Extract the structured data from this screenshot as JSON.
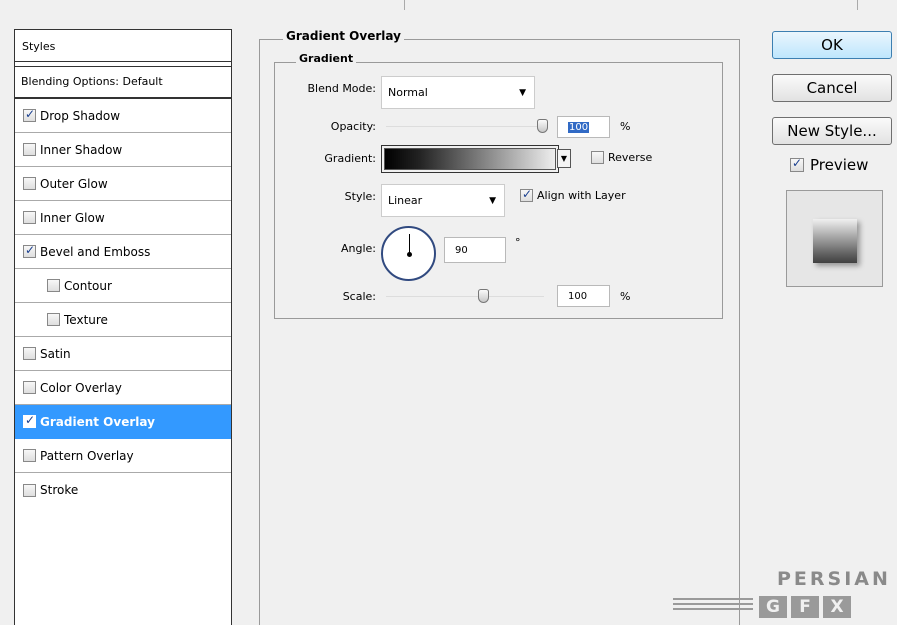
{
  "styles_panel": {
    "header": "Styles",
    "blending_options": "Blending Options: Default",
    "items": [
      {
        "label": "Drop Shadow",
        "checked": true
      },
      {
        "label": "Inner Shadow",
        "checked": false
      },
      {
        "label": "Outer Glow",
        "checked": false
      },
      {
        "label": "Inner Glow",
        "checked": false
      },
      {
        "label": "Bevel and Emboss",
        "checked": true
      },
      {
        "label": "Contour",
        "checked": false
      },
      {
        "label": "Texture",
        "checked": false
      },
      {
        "label": "Satin",
        "checked": false
      },
      {
        "label": "Color Overlay",
        "checked": false
      },
      {
        "label": "Gradient Overlay",
        "checked": true
      },
      {
        "label": "Pattern Overlay",
        "checked": false
      },
      {
        "label": "Stroke",
        "checked": false
      }
    ],
    "selected": "Gradient Overlay"
  },
  "gradient_overlay": {
    "title": "Gradient Overlay",
    "section": "Gradient",
    "blend_mode_label": "Blend Mode:",
    "blend_mode_value": "Normal",
    "opacity_label": "Opacity:",
    "opacity_value": "100",
    "opacity_unit": "%",
    "gradient_label": "Gradient:",
    "reverse_label": "Reverse",
    "reverse_checked": false,
    "style_label": "Style:",
    "style_value": "Linear",
    "align_label": "Align with Layer",
    "align_checked": true,
    "angle_label": "Angle:",
    "angle_value": "90",
    "angle_unit": "°",
    "scale_label": "Scale:",
    "scale_value": "100",
    "scale_unit": "%"
  },
  "buttons": {
    "ok": "OK",
    "cancel": "Cancel",
    "new_style": "New Style...",
    "preview_label": "Preview",
    "preview_checked": true
  },
  "watermark": {
    "text": "PERSIAN",
    "logo_letters": [
      "G",
      "F",
      "X"
    ]
  }
}
